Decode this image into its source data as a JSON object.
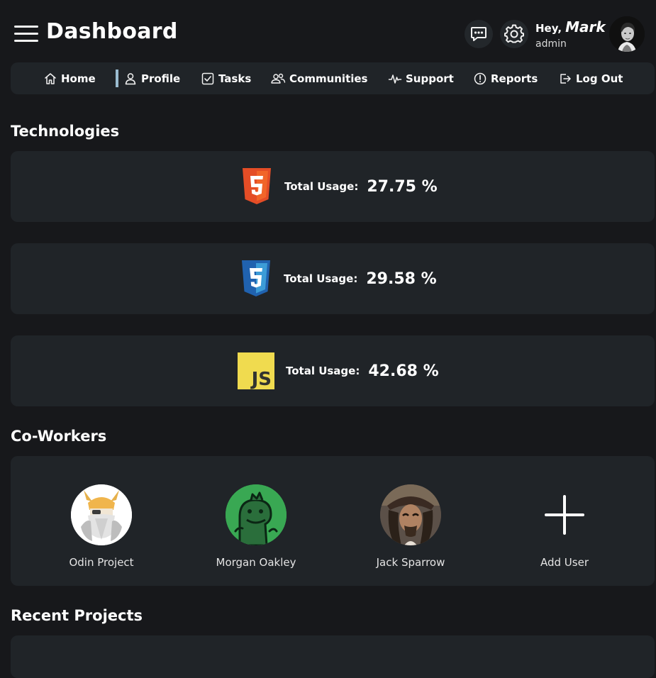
{
  "header": {
    "title": "Dashboard",
    "greeting": "Hey,",
    "user_name": "Mark",
    "user_role": "admin"
  },
  "nav": {
    "items": [
      {
        "label": "Home",
        "icon": "home-icon"
      },
      {
        "label": "Profile",
        "icon": "user-icon"
      },
      {
        "label": "Tasks",
        "icon": "checkbox-icon"
      },
      {
        "label": "Communities",
        "icon": "users-icon"
      },
      {
        "label": "Support",
        "icon": "pulse-icon"
      },
      {
        "label": "Reports",
        "icon": "alert-circle-icon"
      },
      {
        "label": "Log Out",
        "icon": "logout-icon"
      }
    ],
    "active": "Profile"
  },
  "technologies": {
    "title": "Technologies",
    "items": [
      {
        "name": "HTML5",
        "usage_label": "Total Usage:",
        "usage_value": "27.75 %",
        "color": "#e44d26"
      },
      {
        "name": "CSS3",
        "usage_label": "Total Usage:",
        "usage_value": "29.58 %",
        "color": "#2965f1"
      },
      {
        "name": "JS",
        "usage_label": "Total Usage:",
        "usage_value": "42.68 %",
        "color": "#f0db4f"
      }
    ]
  },
  "coworkers": {
    "title": "Co-Workers",
    "items": [
      {
        "name": "Odin Project"
      },
      {
        "name": "Morgan Oakley"
      },
      {
        "name": "Jack Sparrow"
      }
    ],
    "add_label": "Add User"
  },
  "recent_projects": {
    "title": "Recent Projects"
  },
  "colors": {
    "background": "#17181b",
    "card": "#202428",
    "active_indicator": "#9bbcd0"
  }
}
